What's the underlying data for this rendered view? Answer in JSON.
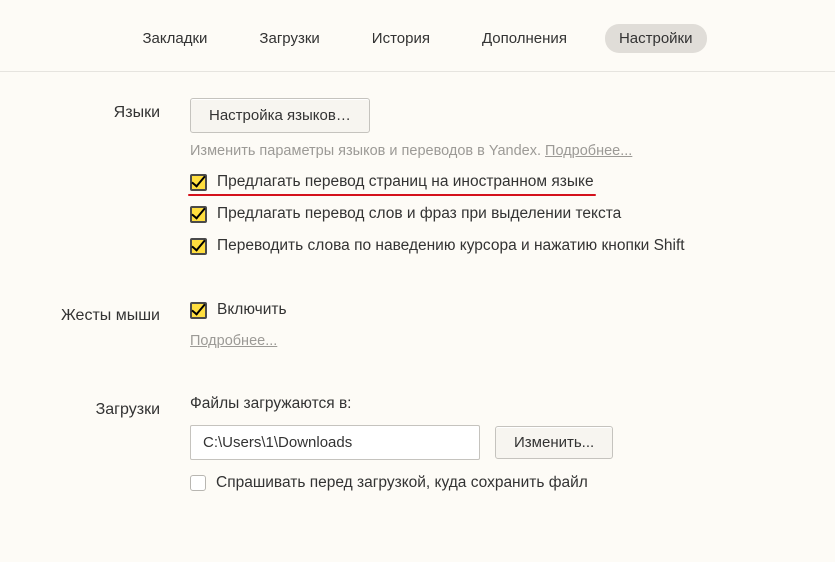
{
  "tabs": {
    "bookmarks": "Закладки",
    "downloads": "Загрузки",
    "history": "История",
    "addons": "Дополнения",
    "settings": "Настройки"
  },
  "languages": {
    "label": "Языки",
    "button": "Настройка языков…",
    "hint_prefix": "Изменить параметры языков и переводов в Yandex. ",
    "hint_link": "Подробнее...",
    "opt_translate_pages": "Предлагать перевод страниц на иностранном языке",
    "opt_translate_words": "Предлагать перевод слов и фраз при выделении текста",
    "opt_translate_hover": "Переводить слова по наведению курсора и нажатию кнопки Shift"
  },
  "gestures": {
    "label": "Жесты мыши",
    "opt_enable": "Включить",
    "more_link": "Подробнее..."
  },
  "downloads": {
    "label": "Загрузки",
    "files_label": "Файлы загружаются в:",
    "path": "C:\\Users\\1\\Downloads",
    "change_button": "Изменить...",
    "opt_ask": "Спрашивать перед загрузкой, куда сохранить файл"
  }
}
